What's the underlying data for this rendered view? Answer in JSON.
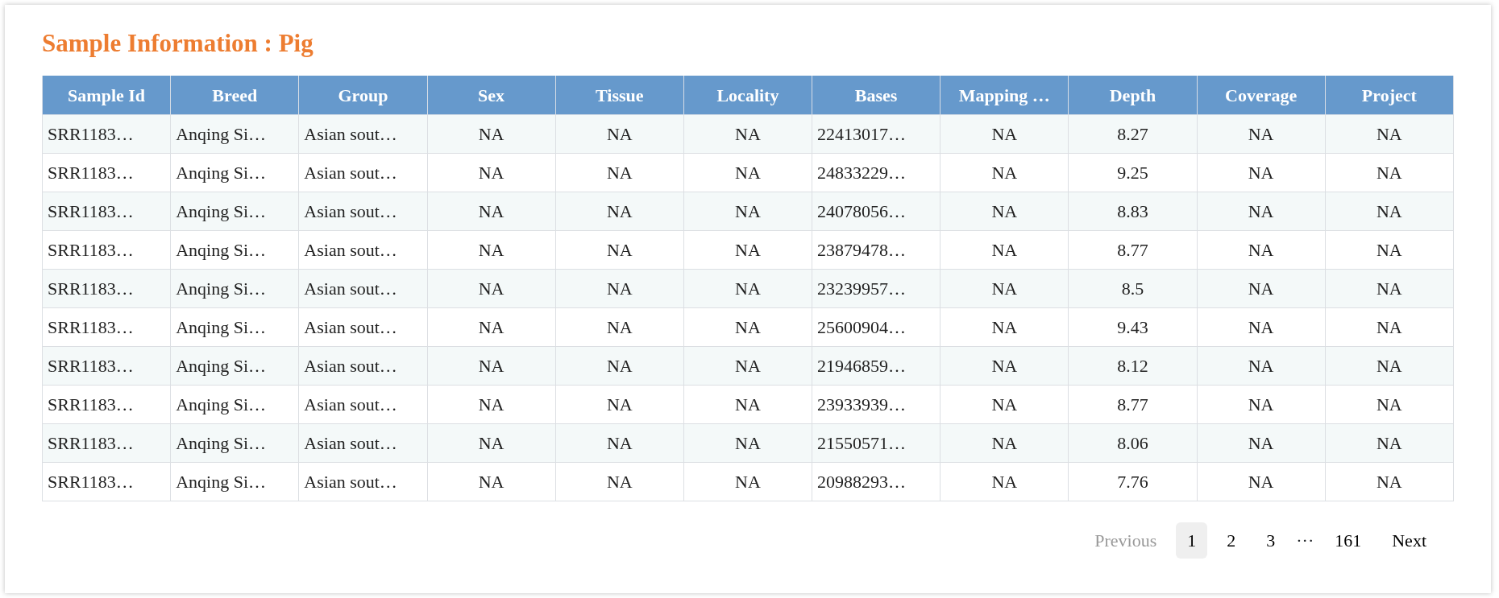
{
  "title": "Sample Information : Pig",
  "table": {
    "columns": [
      "Sample Id",
      "Breed",
      "Group",
      "Sex",
      "Tissue",
      "Locality",
      "Bases",
      "Mapping …",
      "Depth",
      "Coverage",
      "Project"
    ],
    "rows": [
      [
        "SRR1183…",
        "Anqing Si…",
        "Asian sout…",
        "NA",
        "NA",
        "NA",
        "22413017…",
        "NA",
        "8.27",
        "NA",
        "NA"
      ],
      [
        "SRR1183…",
        "Anqing Si…",
        "Asian sout…",
        "NA",
        "NA",
        "NA",
        "24833229…",
        "NA",
        "9.25",
        "NA",
        "NA"
      ],
      [
        "SRR1183…",
        "Anqing Si…",
        "Asian sout…",
        "NA",
        "NA",
        "NA",
        "24078056…",
        "NA",
        "8.83",
        "NA",
        "NA"
      ],
      [
        "SRR1183…",
        "Anqing Si…",
        "Asian sout…",
        "NA",
        "NA",
        "NA",
        "23879478…",
        "NA",
        "8.77",
        "NA",
        "NA"
      ],
      [
        "SRR1183…",
        "Anqing Si…",
        "Asian sout…",
        "NA",
        "NA",
        "NA",
        "23239957…",
        "NA",
        "8.5",
        "NA",
        "NA"
      ],
      [
        "SRR1183…",
        "Anqing Si…",
        "Asian sout…",
        "NA",
        "NA",
        "NA",
        "25600904…",
        "NA",
        "9.43",
        "NA",
        "NA"
      ],
      [
        "SRR1183…",
        "Anqing Si…",
        "Asian sout…",
        "NA",
        "NA",
        "NA",
        "21946859…",
        "NA",
        "8.12",
        "NA",
        "NA"
      ],
      [
        "SRR1183…",
        "Anqing Si…",
        "Asian sout…",
        "NA",
        "NA",
        "NA",
        "23933939…",
        "NA",
        "8.77",
        "NA",
        "NA"
      ],
      [
        "SRR1183…",
        "Anqing Si…",
        "Asian sout…",
        "NA",
        "NA",
        "NA",
        "21550571…",
        "NA",
        "8.06",
        "NA",
        "NA"
      ],
      [
        "SRR1183…",
        "Anqing Si…",
        "Asian sout…",
        "NA",
        "NA",
        "NA",
        "20988293…",
        "NA",
        "7.76",
        "NA",
        "NA"
      ]
    ]
  },
  "pagination": {
    "previous": {
      "label": "Previous",
      "disabled": true
    },
    "items": [
      {
        "kind": "page",
        "label": "1",
        "selected": true
      },
      {
        "kind": "page",
        "label": "2",
        "selected": false
      },
      {
        "kind": "page",
        "label": "3",
        "selected": false
      },
      {
        "kind": "ellipsis",
        "label": "···"
      },
      {
        "kind": "page",
        "label": "161",
        "selected": false
      }
    ],
    "next": {
      "label": "Next",
      "disabled": false
    }
  }
}
